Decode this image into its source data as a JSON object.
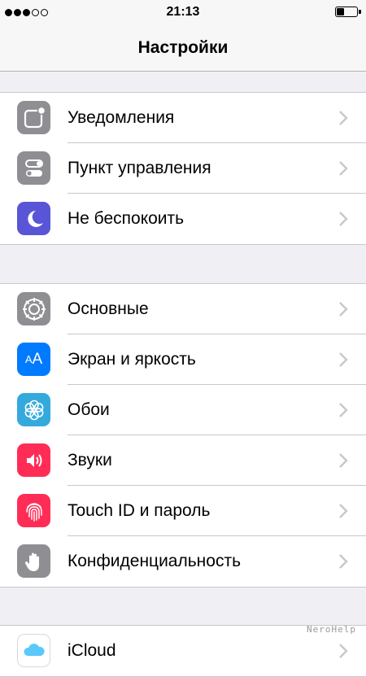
{
  "status": {
    "signal_filled": 3,
    "signal_total": 5,
    "time": "21:13",
    "battery_level": 0.3
  },
  "nav": {
    "title": "Настройки"
  },
  "groups": [
    {
      "items": [
        {
          "label": "Уведомления",
          "icon": "notifications-icon",
          "color": "#8e8e93"
        },
        {
          "label": "Пункт управления",
          "icon": "control-center-icon",
          "color": "#8e8e93"
        },
        {
          "label": "Не беспокоить",
          "icon": "moon-icon",
          "color": "#5856d6"
        }
      ]
    },
    {
      "items": [
        {
          "label": "Основные",
          "icon": "gear-icon",
          "color": "#8e8e93"
        },
        {
          "label": "Экран и яркость",
          "icon": "display-brightness-icon",
          "color": "#007aff",
          "icon_text": "AA"
        },
        {
          "label": "Обои",
          "icon": "wallpaper-flower-icon",
          "color": "#34aadc"
        },
        {
          "label": "Звуки",
          "icon": "speaker-icon",
          "color": "#ff2d55"
        },
        {
          "label": "Touch ID и пароль",
          "icon": "fingerprint-icon",
          "color": "#ff2d55"
        },
        {
          "label": "Конфиденциальность",
          "icon": "hand-icon",
          "color": "#8e8e93"
        }
      ]
    },
    {
      "items": [
        {
          "label": "iCloud",
          "icon": "icloud-icon",
          "color": "#ffffff"
        }
      ]
    }
  ],
  "watermark": "NeroHelp"
}
